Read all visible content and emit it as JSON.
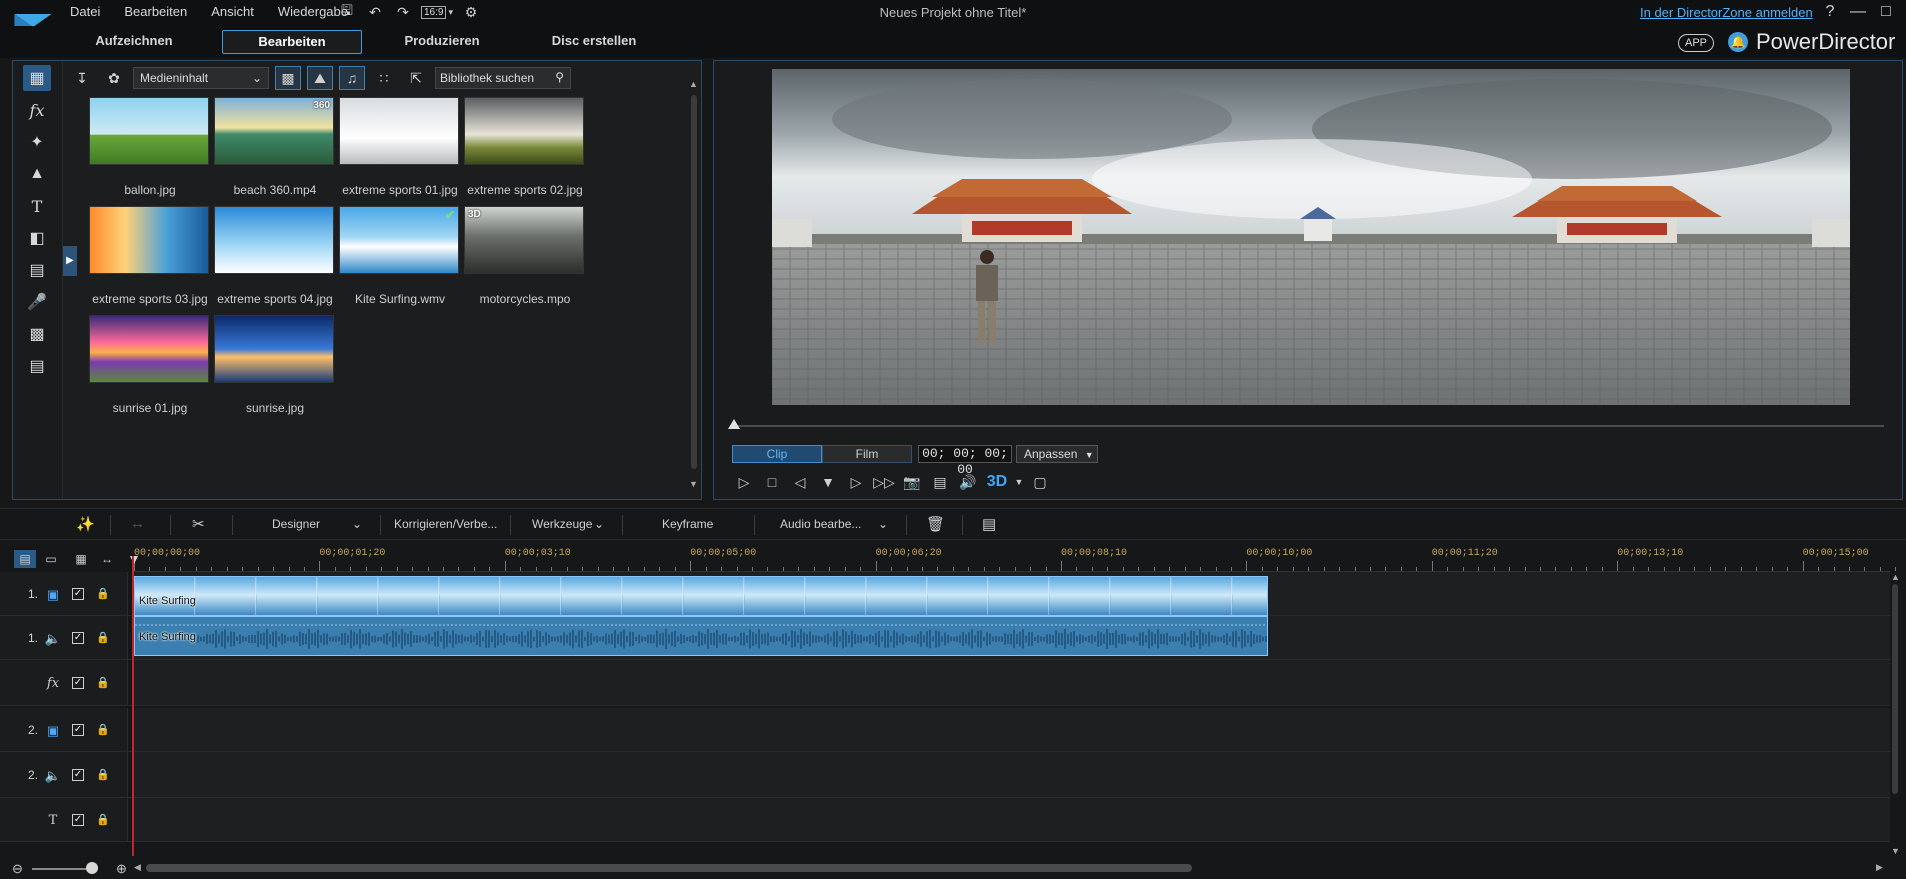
{
  "menu": [
    "Datei",
    "Bearbeiten",
    "Ansicht",
    "Wiedergabe"
  ],
  "toolbar": {
    "ratio": "16:9"
  },
  "window": {
    "title": "Neues Projekt ohne Titel*",
    "dz_link": "In der DirectorZone anmelden",
    "help": "?"
  },
  "modes": [
    "Aufzeichnen",
    "Bearbeiten",
    "Produzieren",
    "Disc erstellen"
  ],
  "active_mode": "Bearbeiten",
  "brand": {
    "app_badge": "APP",
    "name": "PowerDirector"
  },
  "library": {
    "dropdown": "Medieninhalt",
    "search_placeholder": "Bibliothek suchen",
    "items": [
      {
        "name": "ballon.jpg",
        "badge": ""
      },
      {
        "name": "beach 360.mp4",
        "badge": "360"
      },
      {
        "name": "extreme sports 01.jpg",
        "badge": ""
      },
      {
        "name": "extreme sports 02.jpg",
        "badge": ""
      },
      {
        "name": "extreme sports 03.jpg",
        "badge": ""
      },
      {
        "name": "extreme sports 04.jpg",
        "badge": ""
      },
      {
        "name": "Kite Surfing.wmv",
        "badge": ""
      },
      {
        "name": "motorcycles.mpo",
        "badge": "3D"
      },
      {
        "name": "sunrise 01.jpg",
        "badge": ""
      },
      {
        "name": "sunrise.jpg",
        "badge": ""
      }
    ]
  },
  "preview": {
    "clip_label": "Clip",
    "film_label": "Film",
    "timecode": "00; 00; 00; 00",
    "fit_label": "Anpassen",
    "three_d": "3D"
  },
  "edit_toolbar": {
    "designer": "Designer",
    "correct": "Korrigieren/Verbe...",
    "tools": "Werkzeuge",
    "keyframe": "Keyframe",
    "audio": "Audio bearbe..."
  },
  "timeline": {
    "ruler": [
      "00;00;00;00",
      "00;00;01;20",
      "00;00;03;10",
      "00;00;05;00",
      "00;00;06;20",
      "00;00;08;10",
      "00;00;10;00",
      "00;00;11;20",
      "00;00;13;10",
      "00;00;15;00"
    ],
    "tracks": [
      {
        "num": "1.",
        "type": "video"
      },
      {
        "num": "1.",
        "type": "audio"
      },
      {
        "num": "",
        "type": "fx"
      },
      {
        "num": "2.",
        "type": "video"
      },
      {
        "num": "2.",
        "type": "audio"
      },
      {
        "num": "",
        "type": "title"
      }
    ],
    "clip_video_label": "Kite Surfing",
    "clip_audio_label": "Kite Surfing"
  }
}
